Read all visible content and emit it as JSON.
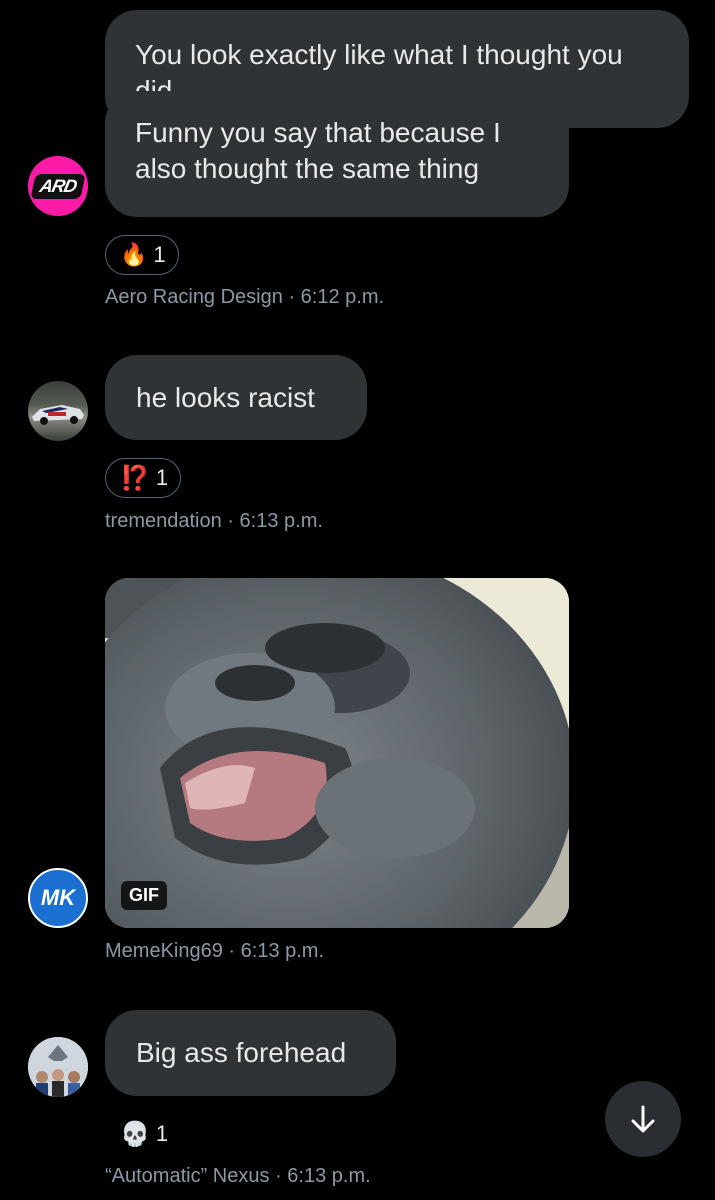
{
  "messages": [
    {
      "text": "You look exactly like what I thought you did"
    },
    {
      "text_line1": "Funny you say that because I",
      "text_line2": "also thought the same thing",
      "avatar_text": "ARD",
      "reaction_emoji": "🔥",
      "reaction_count": "1",
      "sender": "Aero Racing Design",
      "time": "6:12 p.m."
    },
    {
      "text": "he looks racist",
      "reaction_emoji": "⁉️",
      "reaction_count": "1",
      "sender": "tremendation",
      "time": "6:13 p.m."
    },
    {
      "gif_label": "GIF",
      "avatar_text": "MK",
      "sender": "MemeKing69",
      "time": "6:13 p.m."
    },
    {
      "text": "Big ass forehead",
      "reaction_emoji": "💀",
      "reaction_count": "1",
      "sender": "“Automatic” Nexus",
      "time": "6:13 p.m."
    }
  ],
  "separator": "·",
  "scroll_down_icon": "arrow-down-icon",
  "colors": {
    "background": "#000000",
    "bubble": "#2f3336",
    "meta": "#8b98a5",
    "ard_pink": "#ff1aa8",
    "mk_blue": "#1a6fd0"
  }
}
